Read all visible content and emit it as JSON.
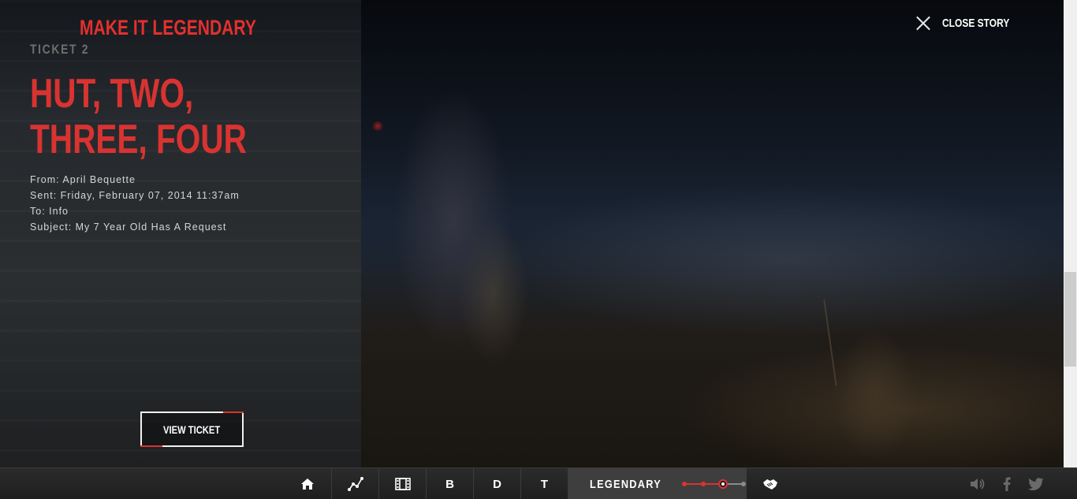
{
  "brand": {
    "title": "MAKE IT LEGENDARY"
  },
  "close": {
    "label": "CLOSE STORY"
  },
  "story": {
    "ticket_label": "TICKET 2",
    "headline": "HUT, TWO, THREE, FOUR",
    "from": "From: April Bequette",
    "sent": "Sent: Friday, February 07, 2014 11:37am",
    "to": "To: Info",
    "subject": "Subject: My 7 Year Old Has A Request",
    "view_ticket_label": "VIEW TICKET"
  },
  "nav": {
    "items": [
      {
        "icon": "home-icon"
      },
      {
        "icon": "chart-line-icon"
      },
      {
        "icon": "film-icon"
      },
      {
        "label": "B"
      },
      {
        "label": "D"
      },
      {
        "label": "T"
      }
    ],
    "active": {
      "label": "LEGENDARY",
      "progress_steps": 4,
      "current_step": 3
    },
    "after_icon": "handshake-icon"
  },
  "social": {
    "icons": [
      "volume-icon",
      "facebook-icon",
      "twitter-icon"
    ]
  },
  "colors": {
    "accent": "#d93331",
    "bar": "#2b2b2b"
  }
}
